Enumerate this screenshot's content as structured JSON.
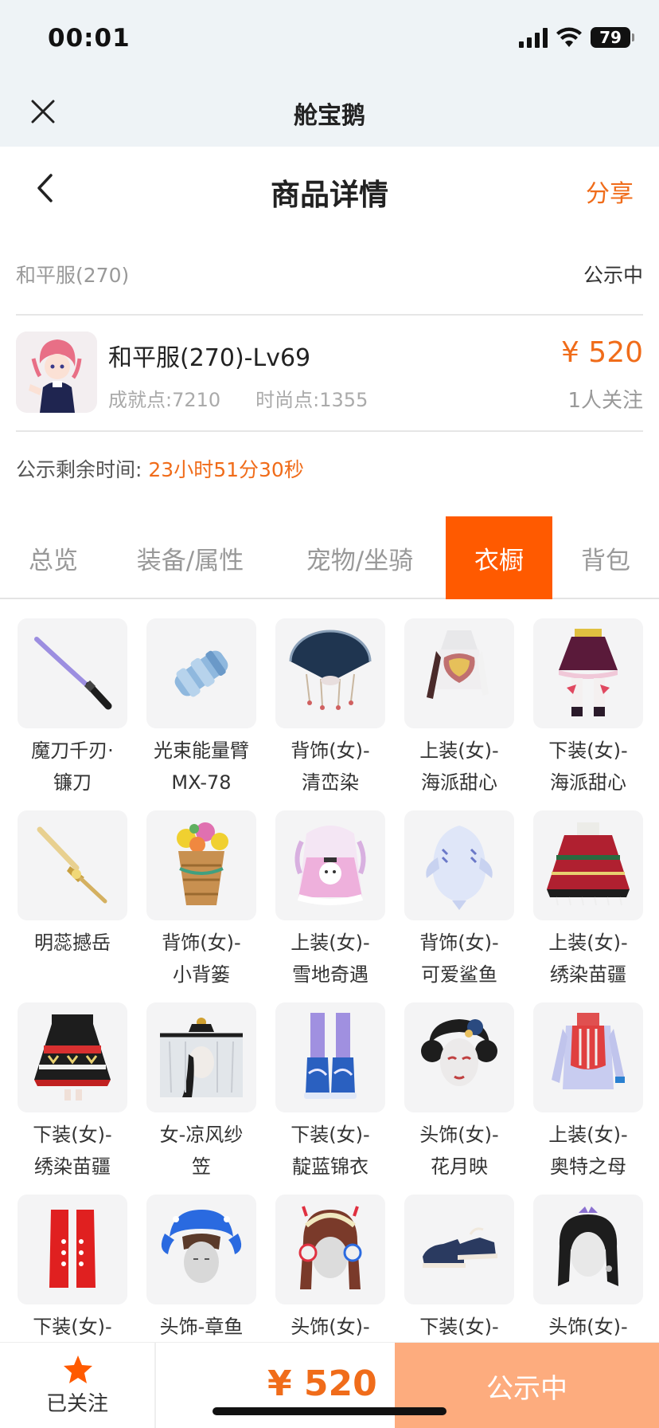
{
  "status_bar": {
    "time": "00:01",
    "battery": "79"
  },
  "miniapp": {
    "title": "舱宝鹅"
  },
  "nav": {
    "title": "商品详情",
    "share": "分享"
  },
  "listing": {
    "server": "和平服(270)",
    "status": "公示中",
    "title": "和平服(270)-Lv69",
    "achievement": "成就点:7210",
    "fashion": "时尚点:1355",
    "price": "¥ 520",
    "followers": "1人关注",
    "timer_label": "公示剩余时间:",
    "timer_value": "23小时51分30秒"
  },
  "tabs": [
    {
      "label": "总览",
      "active": false
    },
    {
      "label": "装备/属性",
      "active": false
    },
    {
      "label": "宠物/坐骑",
      "active": false
    },
    {
      "label": "衣橱",
      "active": true
    },
    {
      "label": "背包",
      "active": false
    }
  ],
  "wardrobe_items": [
    {
      "name": "魔刀千刃·\n镰刀",
      "icon": "katana-icon"
    },
    {
      "name": "光束能量臂\nMX-78",
      "icon": "energy-arm-icon"
    },
    {
      "name": "背饰(女)-\n清峦染",
      "icon": "fan-back-icon"
    },
    {
      "name": "上装(女)-\n海派甜心",
      "icon": "top-icon"
    },
    {
      "name": "下装(女)-\n海派甜心",
      "icon": "skirt-icon"
    },
    {
      "name": "明蕊撼岳",
      "icon": "golden-sword-icon"
    },
    {
      "name": "背饰(女)-\n小背篓",
      "icon": "flower-basket-icon"
    },
    {
      "name": "上装(女)-\n雪地奇遇",
      "icon": "snow-dress-icon"
    },
    {
      "name": "背饰(女)-\n可爱鲨鱼",
      "icon": "shark-icon"
    },
    {
      "name": "上装(女)-\n绣染苗疆",
      "icon": "poncho-icon"
    },
    {
      "name": "下装(女)-\n绣染苗疆",
      "icon": "embroidered-skirt-icon"
    },
    {
      "name": "女-凉风纱\n笠",
      "icon": "veil-hat-icon"
    },
    {
      "name": "下装(女)-\n靛蓝锦衣",
      "icon": "boots-icon"
    },
    {
      "name": "头饰(女)-\n花月映",
      "icon": "headdress-icon"
    },
    {
      "name": "上装(女)-\n奥特之母",
      "icon": "suit-icon"
    },
    {
      "name": "下装(女)-",
      "icon": "red-boots-icon"
    },
    {
      "name": "头饰-章鱼",
      "icon": "octopus-hat-icon"
    },
    {
      "name": "头饰(女)-",
      "icon": "headphones-icon"
    },
    {
      "name": "下装(女)-",
      "icon": "sneakers-icon"
    },
    {
      "name": "头饰(女)-",
      "icon": "tiara-icon"
    }
  ],
  "bottom": {
    "follow_label": "已关注",
    "price": "¥ 520",
    "cta": "公示中"
  },
  "colors": {
    "accent": "#f06c1a",
    "tab_active": "#ff5a00",
    "cta": "#fdac7e"
  }
}
